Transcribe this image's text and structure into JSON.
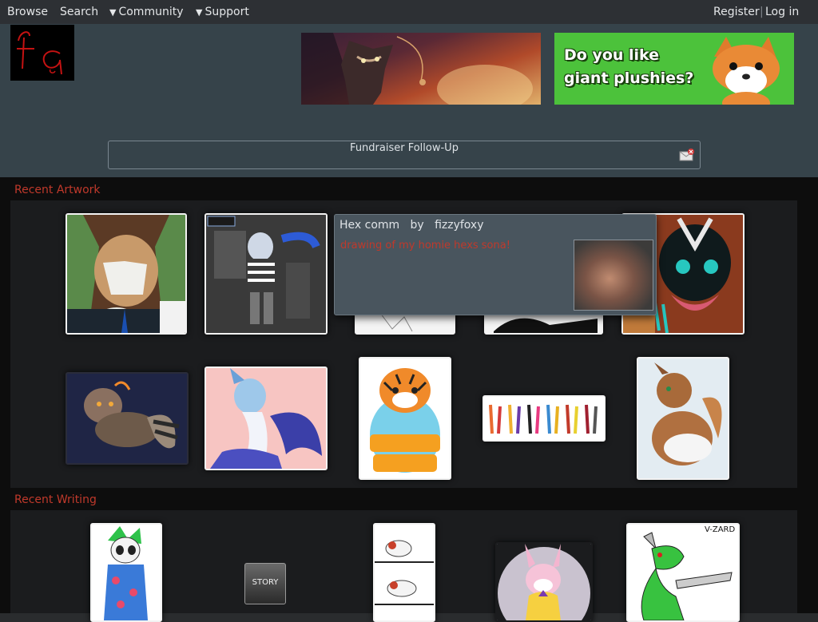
{
  "topnav": {
    "browse": "Browse",
    "search": "Search",
    "community": "Community",
    "support": "Support",
    "register": "Register",
    "separator": "|",
    "login": "Log in"
  },
  "header": {
    "banner2_text": "Do you like giant plushies?"
  },
  "notice": {
    "title": "Fundraiser Follow-Up"
  },
  "sections": {
    "recent_artwork": "Recent Artwork",
    "recent_writing": "Recent Writing"
  },
  "popup": {
    "title": "Hex comm",
    "by": "by",
    "author": "fizzyfoxy",
    "description": "drawing of my homie hexs sona!"
  },
  "writing": {
    "story_badge": "STORY",
    "vzard_label": "V-ZARD"
  },
  "colors": {
    "accent_red": "#c0392b",
    "header_bg": "#36434a",
    "nav_bg": "#2d3034"
  }
}
